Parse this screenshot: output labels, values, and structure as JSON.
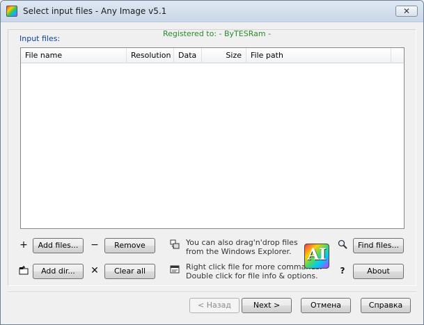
{
  "window": {
    "title": "Select input files - Any Image v5.1",
    "close_symbol": "✕",
    "icon": "any-image-app-icon"
  },
  "labels": {
    "input_files": "Input files:",
    "registered": "Registered to: - ByTESRam -"
  },
  "columns": [
    "File name",
    "Resolution",
    "Data",
    "Size",
    "File path"
  ],
  "files": [],
  "buttons": {
    "add_files": "Add files...",
    "remove": "Remove",
    "add_dir": "Add dir...",
    "clear_all": "Clear all",
    "find_files": "Find files...",
    "about": "About",
    "back": "< Назад",
    "next": "Next >",
    "cancel": "Отмена",
    "help": "Справка"
  },
  "glyphs": {
    "add": "+",
    "remove": "−",
    "clear": "✕",
    "help": "?",
    "search": "🔍"
  },
  "hints": {
    "drag_line1": "You can also drag'n'drop files",
    "drag_line2": "from the Windows Explorer.",
    "click_line1": "Right click file for more commands.",
    "click_line2": "Double click for file info & options."
  },
  "logo_text": "AI",
  "colors": {
    "input_label": "#0b3fa0",
    "registered": "#2a8a2a"
  }
}
